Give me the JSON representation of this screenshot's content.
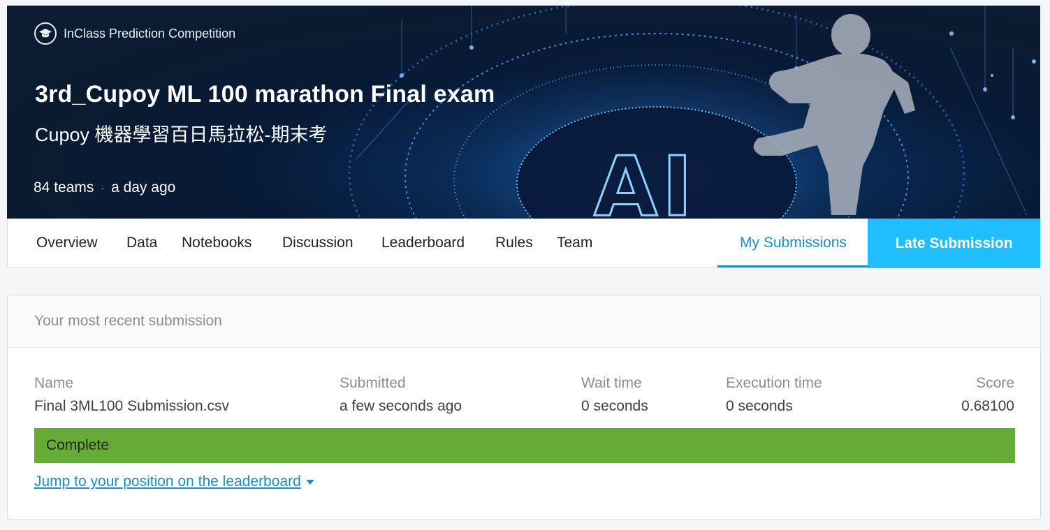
{
  "competition": {
    "type_label": "InClass Prediction Competition",
    "title": "3rd_Cupoy ML 100 marathon Final exam",
    "subtitle": "Cupoy 機器學習百日馬拉松-期末考",
    "teams": "84 teams",
    "separator": "·",
    "updated": "a day ago",
    "banner_text": "AI"
  },
  "nav": {
    "tabs": [
      {
        "label": "Overview"
      },
      {
        "label": "Data"
      },
      {
        "label": "Notebooks"
      },
      {
        "label": "Discussion"
      },
      {
        "label": "Leaderboard"
      },
      {
        "label": "Rules"
      },
      {
        "label": "Team"
      }
    ],
    "my_submissions": "My Submissions",
    "late_submission": "Late Submission"
  },
  "submission": {
    "header": "Your most recent submission",
    "columns": {
      "name": {
        "label": "Name",
        "value": "Final 3ML100 Submission.csv"
      },
      "submitted": {
        "label": "Submitted",
        "value": "a few seconds ago"
      },
      "wait": {
        "label": "Wait time",
        "value": "0 seconds"
      },
      "execution": {
        "label": "Execution time",
        "value": "0 seconds"
      },
      "score": {
        "label": "Score",
        "value": "0.68100"
      }
    },
    "status": "Complete",
    "jump_link": "Jump to your position on the leaderboard "
  },
  "colors": {
    "accent": "#1a8fc7",
    "late_button": "#20beff",
    "status_complete": "#66ab35"
  },
  "icons": {
    "competition_type": "graduation-cap-icon",
    "jump_caret": "caret-down-icon"
  }
}
